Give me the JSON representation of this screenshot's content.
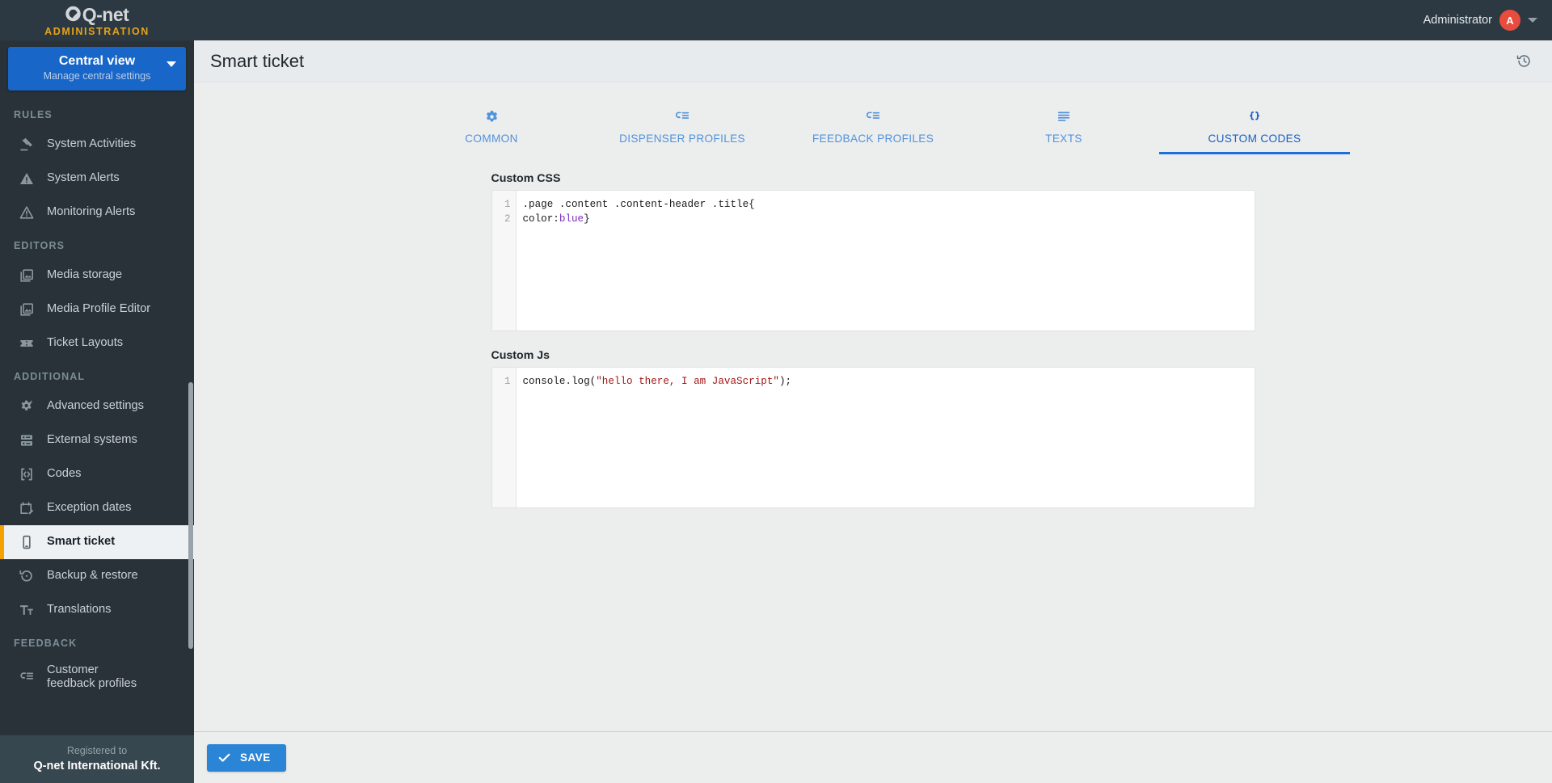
{
  "topbar": {
    "logo_text": "Q-net",
    "logo_subtitle": "ADMINISTRATION",
    "user_name": "Administrator",
    "avatar_initial": "A",
    "caret_icon": "caret-down-icon"
  },
  "sidebar": {
    "view_selector": {
      "title": "Central view",
      "subtitle": "Manage central settings",
      "caret_icon": "caret-down-icon"
    },
    "sections": [
      {
        "label": "RULES",
        "items": [
          {
            "label": "System Activities",
            "icon": "gavel-icon",
            "active": false
          },
          {
            "label": "System Alerts",
            "icon": "warning-filled-icon",
            "active": false
          },
          {
            "label": "Monitoring Alerts",
            "icon": "warning-outline-icon",
            "active": false
          }
        ]
      },
      {
        "label": "EDITORS",
        "items": [
          {
            "label": "Media storage",
            "icon": "image-stack-icon",
            "active": false
          },
          {
            "label": "Media Profile Editor",
            "icon": "image-stack-icon",
            "active": false
          },
          {
            "label": "Ticket Layouts",
            "icon": "ticket-icon",
            "active": false
          }
        ]
      },
      {
        "label": "ADDITIONAL",
        "items": [
          {
            "label": "Advanced settings",
            "icon": "gear-sparkle-icon",
            "active": false
          },
          {
            "label": "External systems",
            "icon": "server-icon",
            "active": false
          },
          {
            "label": "Codes",
            "icon": "code-brackets-icon",
            "active": false
          },
          {
            "label": "Exception dates",
            "icon": "calendar-edit-icon",
            "active": false
          },
          {
            "label": "Smart ticket",
            "icon": "mobile-phone-icon",
            "active": true
          },
          {
            "label": "Backup & restore",
            "icon": "restore-icon",
            "active": false
          },
          {
            "label": "Translations",
            "icon": "translate-icon",
            "active": false
          }
        ]
      },
      {
        "label": "FEEDBACK",
        "items": [
          {
            "label": "Customer feedback profiles",
            "icon": "feedback-list-icon",
            "active": false
          }
        ]
      }
    ],
    "footer": {
      "registered_to_label": "Registered to",
      "company": "Q-net International Kft."
    }
  },
  "content_header": {
    "title": "Smart ticket",
    "history_icon": "history-clock-icon"
  },
  "tabs": [
    {
      "label": "COMMON",
      "icon": "gear-icon",
      "active": false
    },
    {
      "label": "DISPENSER PROFILES",
      "icon": "feedback-list-icon",
      "active": false
    },
    {
      "label": "FEEDBACK PROFILES",
      "icon": "feedback-list-icon",
      "active": false
    },
    {
      "label": "TEXTS",
      "icon": "text-lines-icon",
      "active": false
    },
    {
      "label": "CUSTOM CODES",
      "icon": "curly-braces-icon",
      "active": true
    }
  ],
  "editors": {
    "css": {
      "label": "Custom CSS",
      "line_numbers": [
        "1",
        "2"
      ],
      "lines": [
        [
          {
            "t": ".page .content .content-header .title{",
            "c": "tok-sel"
          }
        ],
        [
          {
            "t": "color:",
            "c": "tok-prop"
          },
          {
            "t": "blue",
            "c": "tok-val"
          },
          {
            "t": "}",
            "c": "tok-plain"
          }
        ]
      ]
    },
    "js": {
      "label": "Custom Js",
      "line_numbers": [
        "1"
      ],
      "lines": [
        [
          {
            "t": "console.log(",
            "c": "tok-plain"
          },
          {
            "t": "\"hello there, I am JavaScript\"",
            "c": "tok-str"
          },
          {
            "t": ");",
            "c": "tok-plain"
          }
        ]
      ]
    }
  },
  "savebar": {
    "save_label": "SAVE",
    "check_icon": "checkmark-icon"
  },
  "colors": {
    "sidebar_bg": "#283238",
    "topbar_bg": "#2c3943",
    "accent_orange": "#f5a200",
    "accent_blue": "#1966c9",
    "tab_blue": "#4f93dd",
    "tab_active_blue": "#1761c4",
    "save_blue": "#2b85d6",
    "avatar_red": "#e74c3c",
    "page_bg": "#eceded"
  }
}
